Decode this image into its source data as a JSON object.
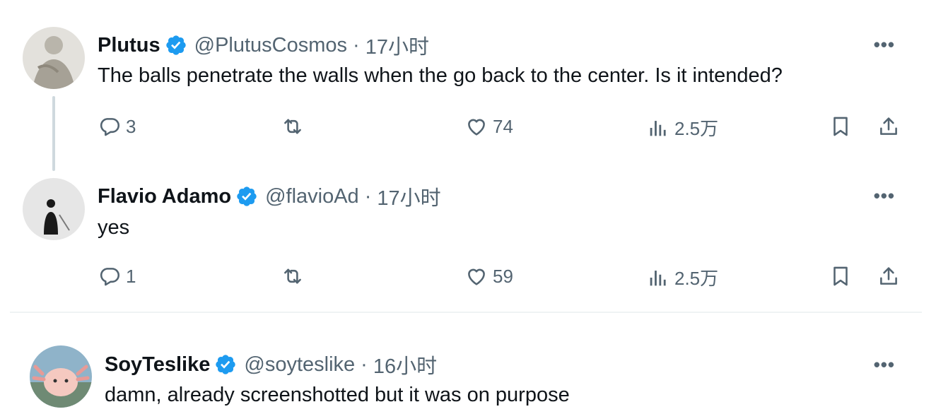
{
  "tweets": [
    {
      "name": "Plutus",
      "handle": "@PlutusCosmos",
      "time": "17小时",
      "text": "The balls penetrate the walls when the go back to the center. Is it intended?",
      "replies": "3",
      "reposts": "",
      "likes": "74",
      "views": "2.5万"
    },
    {
      "name": "Flavio Adamo",
      "handle": "@flavioAd",
      "time": "17小时",
      "text": "yes",
      "replies": "1",
      "reposts": "",
      "likes": "59",
      "views": "2.5万"
    },
    {
      "name": "SoyTeslike",
      "handle": "@soyteslike",
      "time": "16小时",
      "text": "damn, already screenshotted but it was on purpose"
    }
  ],
  "separator": "·",
  "more_glyph": "•••",
  "colors": {
    "verified": "#1d9bf0",
    "muted": "#536471",
    "text": "#0f1419",
    "thread_line": "#cfd9de"
  },
  "icons": [
    "verified-badge-icon",
    "reply-icon",
    "repost-icon",
    "like-icon",
    "views-icon",
    "bookmark-icon",
    "share-icon",
    "more-icon"
  ]
}
